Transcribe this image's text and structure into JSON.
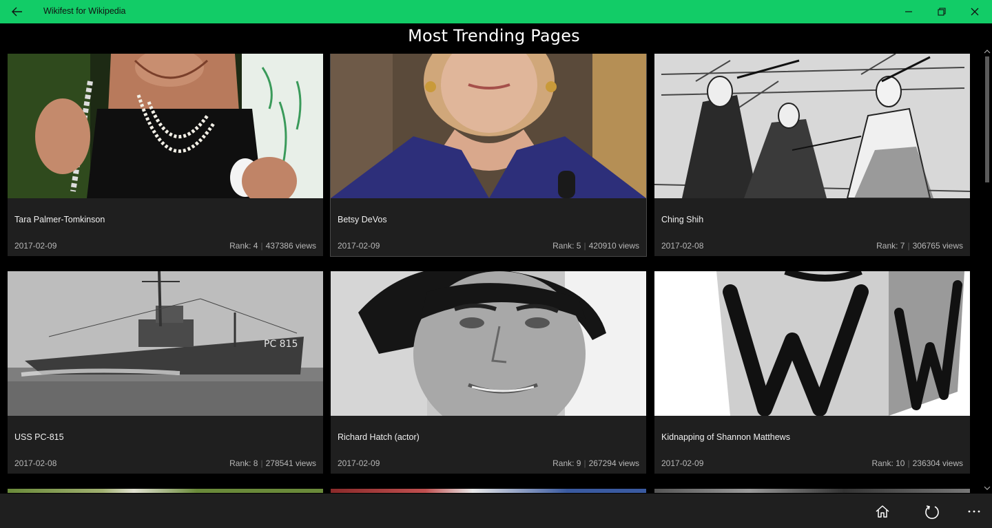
{
  "window": {
    "title": "Wikifest for Wikipedia"
  },
  "page": {
    "heading": "Most Trending Pages"
  },
  "labels": {
    "rank_prefix": "Rank: ",
    "views_suffix": " views"
  },
  "cards": [
    {
      "title": "Tara Palmer-Tomkinson",
      "date": "2017-02-09",
      "rank": 4,
      "views": 437386,
      "image": "photo-woman-pearl-necklace"
    },
    {
      "title": "Betsy DeVos",
      "date": "2017-02-09",
      "rank": 5,
      "views": 420910,
      "image": "photo-woman-blue-jacket"
    },
    {
      "title": "Ching Shih",
      "date": "2017-02-08",
      "rank": 7,
      "views": 306765,
      "image": "engraving-pirate-sword-fight"
    },
    {
      "title": "USS PC-815",
      "date": "2017-02-08",
      "rank": 8,
      "views": 278541,
      "image": "photo-navy-ship-pc815"
    },
    {
      "title": "Richard Hatch (actor)",
      "date": "2017-02-09",
      "rank": 9,
      "views": 267294,
      "image": "photo-man-portrait-bw"
    },
    {
      "title": "Kidnapping of Shannon Matthews",
      "date": "2017-02-09",
      "rank": 10,
      "views": 236304,
      "image": "wikipedia-w-cube-logo"
    }
  ],
  "appbar": {
    "icons": [
      "home-icon",
      "refresh-icon",
      "more-icon"
    ]
  },
  "colors": {
    "accent": "#12cc67",
    "card_bg": "#1f1f1f",
    "page_bg": "#000000",
    "muted_text": "#b8b8b8"
  }
}
